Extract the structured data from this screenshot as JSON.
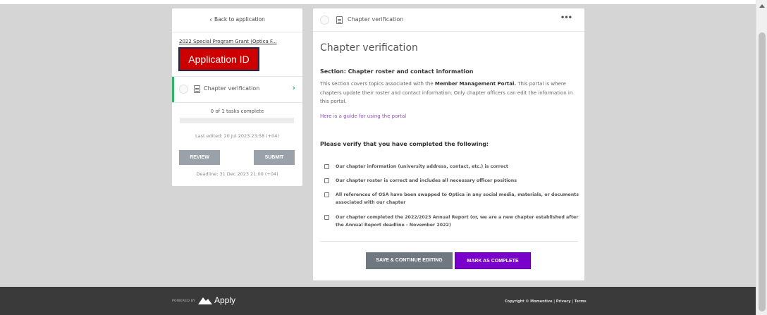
{
  "sidebar": {
    "back_label": "Back to application",
    "grant_title": "2022 Special Program Grant (Optica F...",
    "app_id_label": "Application ID",
    "task_label": "Chapter verification",
    "tasks_complete": "0 of 1 tasks complete",
    "progress": 0,
    "last_edited": "Last edited: 20 Jul 2023 23:58 (+04)",
    "review_label": "REVIEW",
    "submit_label": "SUBMIT",
    "deadline": "Deadline: 31 Dec 2023 21:00 (+04)"
  },
  "main": {
    "header_title": "Chapter verification",
    "more_label": "•••",
    "title": "Chapter verification",
    "section_heading": "Section: Chapter roster and contact information",
    "para_pre": "This section covers topics associated with the ",
    "para_bold": "Member Management Portal.",
    "para_post": " This portal is where chapters update their roster and contact information. Only chapter officers can edit the information in this portal.",
    "guide_link": "Here is a guide for using the portal",
    "verify_heading": "Please verify that you have completed the following:",
    "checklist": [
      "Our chapter information (university address, contact, etc.) is correct",
      "Our chapter roster is correct and includes all necessary officer positions",
      "All references of OSA have been swapped to Optica in any social media, materials, or documents associated with our chapter",
      "Our chapter completed the 2022/2023 Annual Report (or, we are a new chapter established after the Annual Report deadline - November 2022)"
    ],
    "save_label": "SAVE & CONTINUE EDITING",
    "complete_label": "MARK AS COMPLETE"
  },
  "footer": {
    "powered_by": "POWERED BY",
    "brand": "Apply",
    "copyright": "Copyright © Momentive | Privacy | Terms"
  },
  "colors": {
    "accent_green": "#2db36a",
    "accent_purple": "#7a00cc",
    "app_id_red": "#cc0000",
    "footer_bg": "#3a3a3a"
  }
}
